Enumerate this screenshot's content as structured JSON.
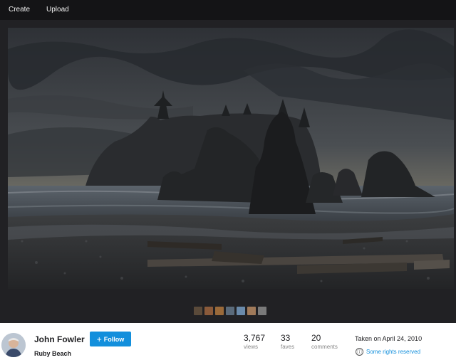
{
  "nav": {
    "create_label": "Create",
    "upload_label": "Upload"
  },
  "filmstrip": {
    "thumb_colors": [
      "#5a4a3a",
      "#8a5a3a",
      "#9a6a3a",
      "#5a6a7a",
      "#6a8aaa",
      "#a07a5a",
      "#7a7a7a"
    ]
  },
  "owner": {
    "name": "John Fowler",
    "follow_label": "Follow"
  },
  "photo": {
    "title": "Ruby Beach",
    "taken": "Taken on April 24, 2010"
  },
  "stats": {
    "views": {
      "value": "3,767",
      "label": "views"
    },
    "faves": {
      "value": "33",
      "label": "faves"
    },
    "comments": {
      "value": "20",
      "label": "comments"
    }
  },
  "license": {
    "text": "Some rights reserved"
  }
}
